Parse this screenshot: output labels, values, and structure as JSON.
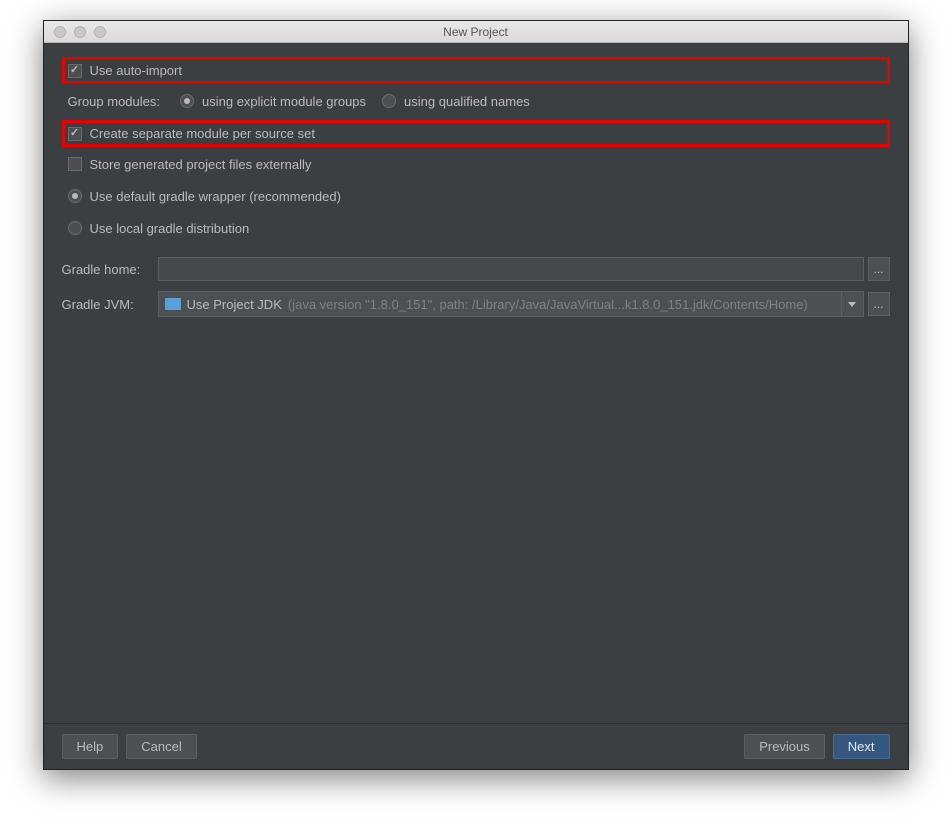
{
  "window": {
    "title": "New Project"
  },
  "options": {
    "auto_import": "Use auto-import",
    "group_modules_label": "Group modules:",
    "radio_explicit": "using explicit module groups",
    "radio_qualified": "using qualified names",
    "separate_module": "Create separate module per source set",
    "store_externally": "Store generated project files externally",
    "use_default_wrapper": "Use default gradle wrapper (recommended)",
    "use_local_dist": "Use local gradle distribution"
  },
  "form": {
    "gradle_home_label": "Gradle home:",
    "gradle_home_value": "",
    "gradle_jvm_label": "Gradle JVM:",
    "gradle_jvm_main": "Use Project JDK",
    "gradle_jvm_sub": "(java version \"1.8.0_151\", path: /Library/Java/JavaVirtual...k1.8.0_151.jdk/Contents/Home)",
    "ellipsis": "..."
  },
  "footer": {
    "help": "Help",
    "cancel": "Cancel",
    "previous": "Previous",
    "next": "Next"
  }
}
